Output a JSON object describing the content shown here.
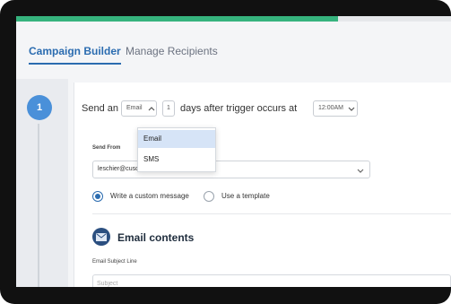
{
  "progress": {
    "percent": 74,
    "color": "#36b37e"
  },
  "tabs": [
    {
      "label": "Campaign Builder",
      "active": true
    },
    {
      "label": "Manage Recipients",
      "active": false
    }
  ],
  "step": {
    "number": "1"
  },
  "send_row": {
    "prefix": "Send an",
    "channel_value": "Email",
    "days_value": "1",
    "middle": "days after trigger occurs at",
    "time_value": "12:00AM"
  },
  "channel_options": [
    {
      "label": "Email",
      "selected": true
    },
    {
      "label": "SMS",
      "selected": false
    }
  ],
  "send_from": {
    "label": "Send From",
    "value": "leschier@cusonvers.com"
  },
  "message_options": [
    {
      "label": "Write a custom message",
      "checked": true
    },
    {
      "label": "Use a template",
      "checked": false
    }
  ],
  "email_contents": {
    "title": "Email contents",
    "icon": "envelope-icon",
    "subject_label": "Email Subject Line",
    "subject_placeholder": "Subject"
  },
  "colors": {
    "accent": "#2b6cb0",
    "step_circle": "#4a90d9",
    "section_icon_bg": "#2b4f80"
  }
}
